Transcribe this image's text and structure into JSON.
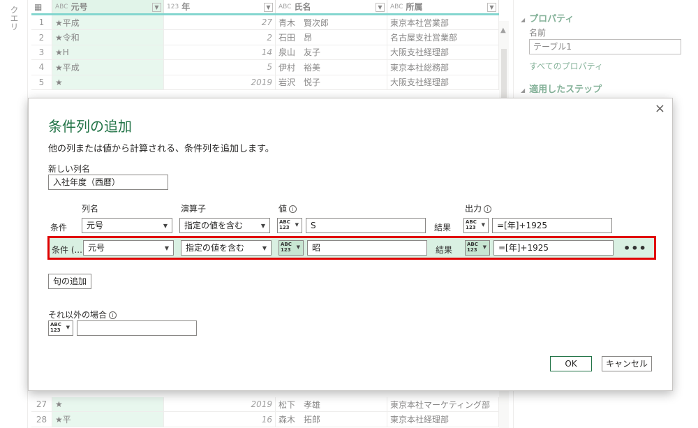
{
  "left_rail": {
    "label": "クエリ"
  },
  "grid": {
    "columns": [
      {
        "type": "ABC",
        "name": "元号"
      },
      {
        "type": "123",
        "name": "年"
      },
      {
        "type": "ABC",
        "name": "氏名"
      },
      {
        "type": "ABC",
        "name": "所属"
      }
    ],
    "rows_top": [
      {
        "n": "1",
        "era": "★平成",
        "year": "27",
        "name": "青木　賢次郎",
        "dept": "東京本社営業部"
      },
      {
        "n": "2",
        "era": "★令和",
        "year": "2",
        "name": "石田　昂",
        "dept": "名古屋支社営業部"
      },
      {
        "n": "3",
        "era": "★H",
        "year": "14",
        "name": "泉山　友子",
        "dept": "大阪支社経理部"
      },
      {
        "n": "4",
        "era": "★平成",
        "year": "5",
        "name": "伊村　裕美",
        "dept": "東京本社総務部"
      },
      {
        "n": "5",
        "era": "★",
        "year": "2019",
        "name": "岩沢　悦子",
        "dept": "大阪支社経理部"
      }
    ],
    "rows_bottom": [
      {
        "n": "27",
        "era": "★",
        "year": "2019",
        "name": "松下　孝雄",
        "dept": "東京本社マーケティング部"
      },
      {
        "n": "28",
        "era": "★平",
        "year": "16",
        "name": "森木　拓郎",
        "dept": "東京本社経理部"
      }
    ]
  },
  "properties": {
    "header": "プロパティ",
    "name_label": "名前",
    "name_value": "テーブル1",
    "all_props_link": "すべてのプロパティ",
    "steps_header": "適用したステップ"
  },
  "dialog": {
    "title": "条件列の追加",
    "description": "他の列または値から計算される、条件列を追加します。",
    "new_col_label": "新しい列名",
    "new_col_value": "入社年度（西暦）",
    "col_headers": {
      "column": "列名",
      "operator": "演算子",
      "value": "値",
      "output": "出力"
    },
    "rows": [
      {
        "label": "条件",
        "column": "元号",
        "operator": "指定の値を含む",
        "value": "S",
        "result_label": "結果",
        "output": "=[年]+1925"
      },
      {
        "label": "条件 (...",
        "column": "元号",
        "operator": "指定の値を含む",
        "value": "昭",
        "result_label": "結果",
        "output": "=[年]+1925"
      }
    ],
    "type_icon": "ABC\n123",
    "add_clause": "句の追加",
    "else_label": "それ以外の場合",
    "else_value": "",
    "ok": "OK",
    "cancel": "キャンセル",
    "info_icon": "i",
    "more_icon": "•••",
    "close_icon": "×"
  },
  "colors": {
    "accent": "#217346",
    "highlight_border": "#e00000",
    "row_highlight": "#d9f0e2"
  }
}
